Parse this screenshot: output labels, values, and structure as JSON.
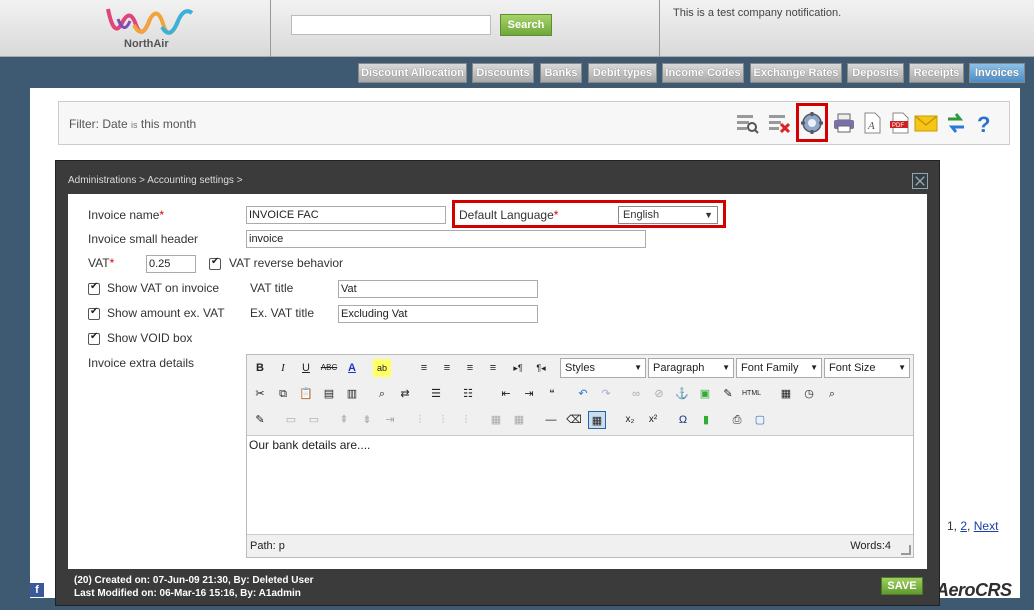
{
  "header": {
    "logo_text": "NorthAir",
    "search_placeholder": "",
    "search_button": "Search",
    "notification": "This is a test company notification."
  },
  "tabs": [
    {
      "label": "Discount Allocation",
      "active": false
    },
    {
      "label": "Discounts",
      "active": false
    },
    {
      "label": "Banks",
      "active": false
    },
    {
      "label": "Debit types",
      "active": false
    },
    {
      "label": "Income Codes",
      "active": false
    },
    {
      "label": "Exchange Rates",
      "active": false
    },
    {
      "label": "Deposits",
      "active": false
    },
    {
      "label": "Receipts",
      "active": false
    },
    {
      "label": "Invoices",
      "active": true
    }
  ],
  "filter": {
    "prefix": "Filter: Date",
    "operator": "is",
    "value": "this month"
  },
  "toolbar_icons": [
    "search-list-icon",
    "clear-filter-icon",
    "settings-gear-icon",
    "print-icon",
    "export-text-icon",
    "export-pdf-icon",
    "email-icon",
    "refresh-icon",
    "help-icon"
  ],
  "pagination": {
    "prefix": "1,",
    "page2": "2",
    "separator": ",",
    "next": "Next"
  },
  "modal": {
    "breadcrumb": "Administrations > Accounting settings >",
    "invoice_name_label": "Invoice name",
    "invoice_name_value": "INVOICE FAC",
    "default_language_label": "Default Language",
    "default_language_value": "English",
    "small_header_label": "Invoice small header",
    "small_header_value": "invoice",
    "vat_label": "VAT",
    "vat_value": "0.25",
    "vat_reverse_label": "VAT reverse behavior",
    "show_vat_label": "Show VAT on invoice",
    "vat_title_label": "VAT title",
    "vat_title_value": "Vat",
    "show_amount_ex_label": "Show amount ex. VAT",
    "ex_vat_title_label": "Ex. VAT title",
    "ex_vat_title_value": "Excluding Vat",
    "show_void_label": "Show VOID box",
    "extra_details_label": "Invoice extra details",
    "required_mark": "*",
    "editor": {
      "styles": "Styles",
      "paragraph": "Paragraph",
      "font_family": "Font Family",
      "font_size": "Font Size",
      "content": "Our bank details are....",
      "path": "Path: p",
      "words": "Words:4"
    },
    "footer_created": "(20) Created on: 07-Jun-09 21:30, By: Deleted User",
    "footer_modified": "Last Modified on: 06-Mar-16 15:16, By: A1admin",
    "save_label": "SAVE"
  },
  "brand_mark": "AeroCRS",
  "colors": {
    "highlight": "#d40000",
    "active_tab": "#4d8cc4",
    "save_green": "#6fa83a"
  }
}
